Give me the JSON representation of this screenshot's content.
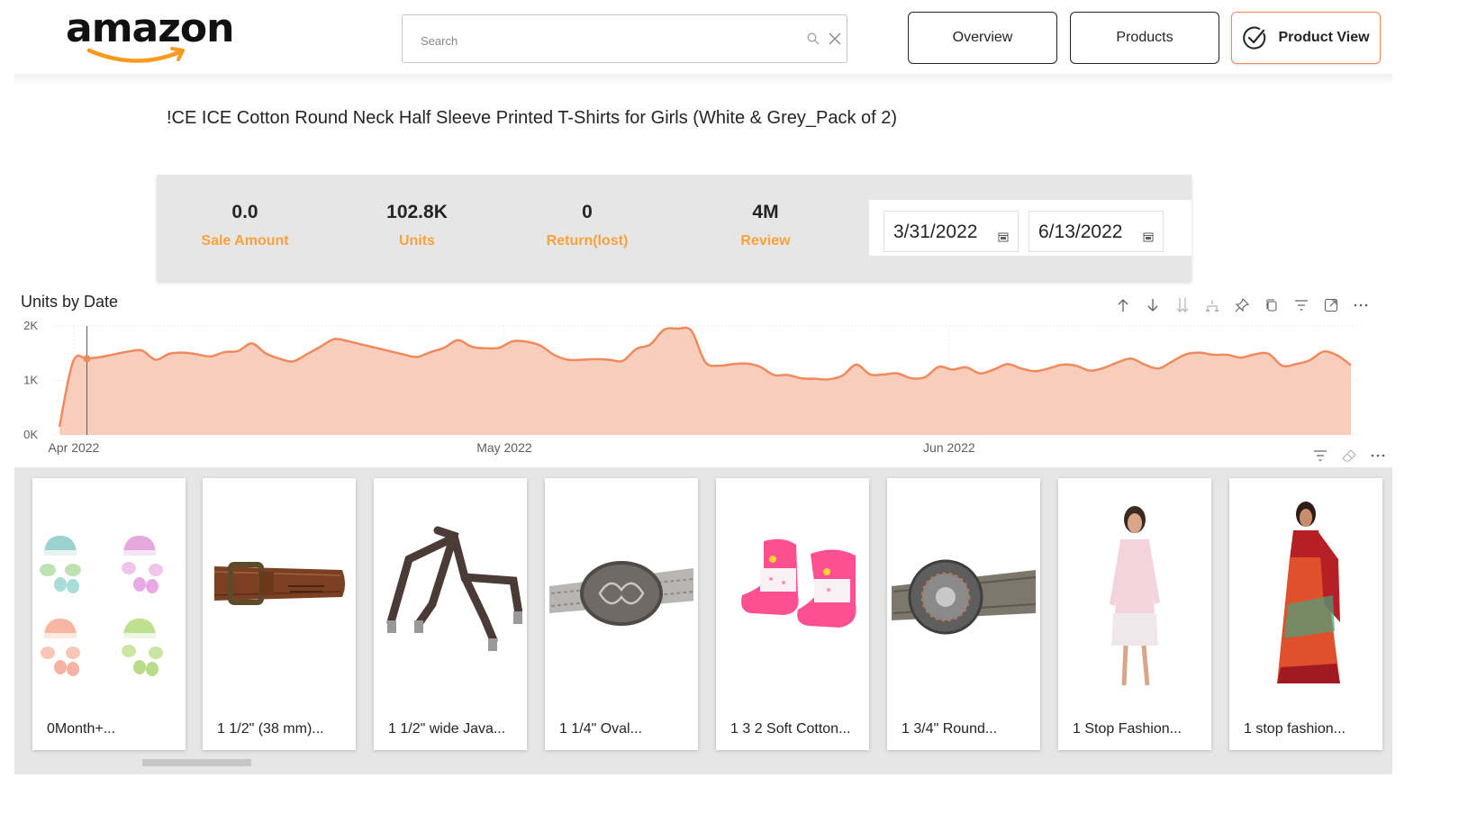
{
  "header": {
    "logo_text": "amazon",
    "search_placeholder": "Search",
    "nav": [
      {
        "label": "Overview"
      },
      {
        "label": "Products"
      },
      {
        "label": "Product View"
      }
    ]
  },
  "product": {
    "title": "!CE ICE Cotton Round Neck Half Sleeve Printed T-Shirts for Girls (White & Grey_Pack of 2)"
  },
  "kpis": [
    {
      "value": "0.0",
      "label": "Sale Amount"
    },
    {
      "value": "102.8K",
      "label": "Units"
    },
    {
      "value": "0",
      "label": "Return(lost)"
    },
    {
      "value": "4M",
      "label": "Review"
    }
  ],
  "date_range": {
    "start": "3/31/2022",
    "end": "6/13/2022"
  },
  "colors": {
    "accent": "#f08a5d",
    "area_fill": "#f7cbb8",
    "kpi_label": "#f7a23b",
    "panel_bg": "#e6e6e6"
  },
  "chart_data": {
    "type": "area",
    "title": "Units by Date",
    "yticks": [
      "2K",
      "1K",
      "0K"
    ],
    "ylim": [
      0,
      2000
    ],
    "xticks": [
      "Apr 2022",
      "May 2022",
      "Jun 2022"
    ],
    "x_start": "2022-03-31",
    "x_end": "2022-06-29",
    "grid": true,
    "marker_date": "2022-04-02",
    "series": [
      {
        "values": [
          150,
          1350,
          1400,
          1430,
          1480,
          1530,
          1550,
          1380,
          1490,
          1510,
          1480,
          1440,
          1520,
          1540,
          1680,
          1500,
          1400,
          1350,
          1480,
          1620,
          1760,
          1720,
          1660,
          1600,
          1540,
          1480,
          1430,
          1520,
          1600,
          1740,
          1620,
          1590,
          1600,
          1720,
          1710,
          1640,
          1470,
          1380,
          1380,
          1390,
          1380,
          1360,
          1580,
          1660,
          1930,
          1950,
          1910,
          1340,
          1270,
          1300,
          1310,
          1250,
          1100,
          1100,
          1040,
          1030,
          1020,
          1090,
          1290,
          1110,
          1110,
          1130,
          1040,
          1060,
          1250,
          1200,
          1240,
          1130,
          1200,
          1300,
          1220,
          1170,
          1220,
          1290,
          1270,
          1180,
          1230,
          1330,
          1400,
          1290,
          1220,
          1350,
          1480,
          1510,
          1470,
          1470,
          1420,
          1480,
          1490,
          1270,
          1300,
          1370,
          1530,
          1460,
          1280
        ]
      }
    ]
  },
  "gallery": [
    {
      "name": "0Month+...",
      "icon": "baby-mittens-set-icon"
    },
    {
      "name": "1 1/2\" (38 mm)...",
      "icon": "leather-belt-icon"
    },
    {
      "name": "1 1/2\" wide Java...",
      "icon": "suspenders-icon"
    },
    {
      "name": "1 1/4\" Oval...",
      "icon": "oval-buckle-belt-icon"
    },
    {
      "name": "1 3 2 Soft Cotton...",
      "icon": "baby-socks-icon"
    },
    {
      "name": "1 3/4\" Round...",
      "icon": "round-buckle-belt-icon"
    },
    {
      "name": "1 Stop Fashion...",
      "icon": "woman-dress-icon"
    },
    {
      "name": "1 stop fashion...",
      "icon": "saree-icon"
    }
  ]
}
